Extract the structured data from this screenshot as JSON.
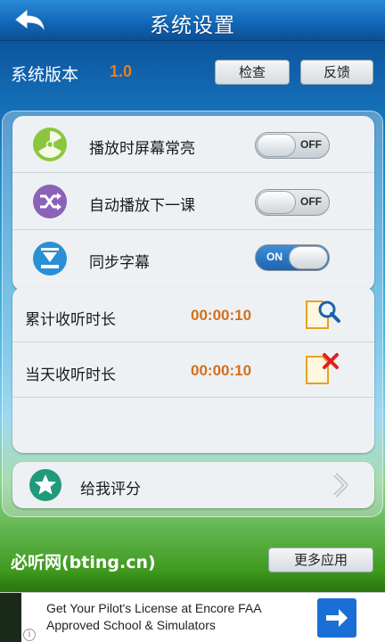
{
  "header": {
    "title": "系统设置",
    "back_icon": "back-arrow-icon"
  },
  "version": {
    "label": "系统版本",
    "value": "1.0",
    "check_label": "检查",
    "feedback_label": "反馈"
  },
  "settings": [
    {
      "label": "播放时屏幕常亮",
      "icon": "radiation-icon",
      "toggle_text": "OFF",
      "on": false
    },
    {
      "label": "自动播放下一课",
      "icon": "shuffle-icon",
      "toggle_text": "OFF",
      "on": false
    },
    {
      "label": "同步字幕",
      "icon": "download-icon",
      "toggle_text": "ON",
      "on": true
    }
  ],
  "stats": [
    {
      "label": "累计收听时长",
      "value": "00:00:10",
      "icon": "search-document-icon"
    },
    {
      "label": "当天收听时长",
      "value": "00:00:10",
      "icon": "delete-document-icon"
    }
  ],
  "rate": {
    "label": "给我评分",
    "icon": "star-icon",
    "chevron": "chevron-right-icon"
  },
  "footer": {
    "site_label": "必听网(bting.cn)",
    "more_label": "更多应用"
  },
  "ad": {
    "text": "Get Your Pilot's License at Encore FAA Approved School & Simulators",
    "info": "i",
    "arrow_icon": "arrow-right-icon"
  },
  "colors": {
    "accent": "#d2701c",
    "title_bar": "#1268b8",
    "toggle_on": "#1f64b0"
  }
}
